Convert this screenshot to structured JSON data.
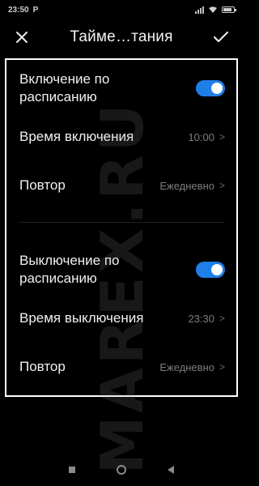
{
  "status_bar": {
    "time": "23:50",
    "carrier_icon": "P"
  },
  "header": {
    "title": "Тайме…тания",
    "close_icon": "close-icon",
    "confirm_icon": "check-icon"
  },
  "schedule_on": {
    "label": "Включение по расписанию",
    "toggle_state": true,
    "time_label": "Время включения",
    "time_value": "10:00",
    "repeat_label": "Повтор",
    "repeat_value": "Ежедневно"
  },
  "schedule_off": {
    "label": "Выключение по расписанию",
    "toggle_state": true,
    "time_label": "Время выключения",
    "time_value": "23:30",
    "repeat_label": "Повтор",
    "repeat_value": "Ежедневно"
  },
  "watermark": {
    "text": "MAREX.RU"
  },
  "colors": {
    "accent": "#1e7fe8",
    "background": "#000000",
    "text_primary": "#f1f1f1",
    "text_secondary": "#7d7d7d"
  }
}
